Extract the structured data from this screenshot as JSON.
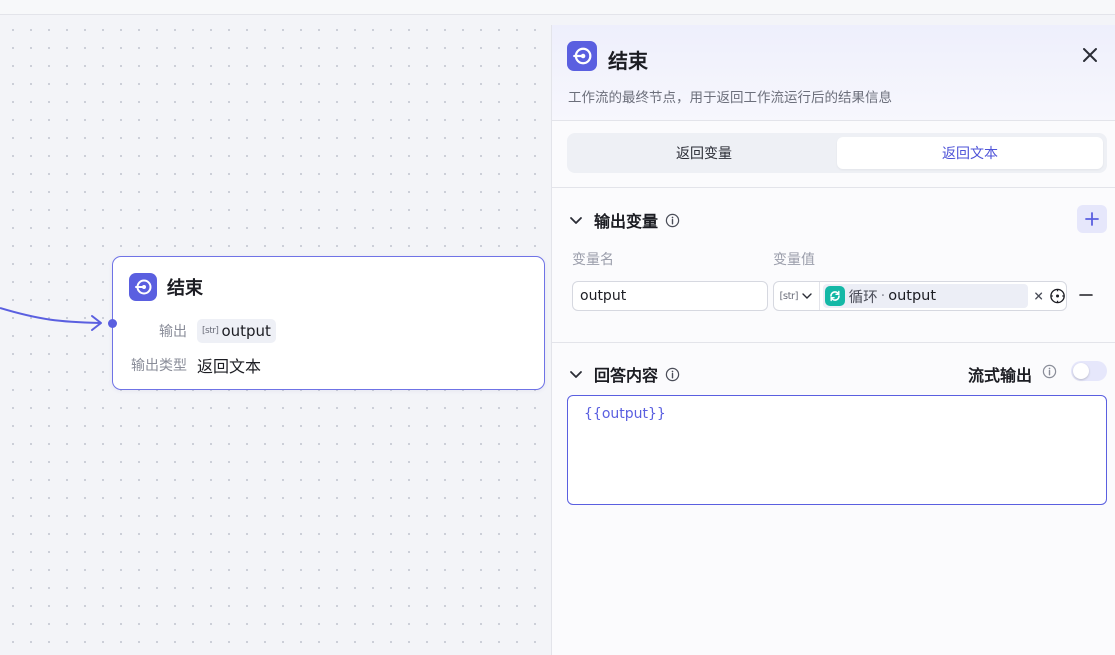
{
  "node": {
    "title": "结束",
    "output_label": "输出",
    "output_type_tag": "[str]",
    "output_value": "output",
    "output_type_label": "输出类型",
    "output_type_value": "返回文本"
  },
  "panel": {
    "title": "结束",
    "description": "工作流的最终节点，用于返回工作流运行后的结果信息",
    "tabs": [
      {
        "label": "返回变量",
        "active": false
      },
      {
        "label": "返回文本",
        "active": true
      }
    ],
    "output_section": {
      "title": "输出变量",
      "col_name": "变量名",
      "col_value": "变量值",
      "rows": [
        {
          "name": "output",
          "type_tag": "[str]",
          "ref_node": "循环",
          "ref_sep": "·",
          "ref_var": "output"
        }
      ]
    },
    "answer_section": {
      "title": "回答内容",
      "stream_label": "流式输出",
      "stream_on": false,
      "content": "{{output}}"
    }
  },
  "colors": {
    "accent": "#5a5fe0",
    "loop_icon": "#14b8a6"
  }
}
